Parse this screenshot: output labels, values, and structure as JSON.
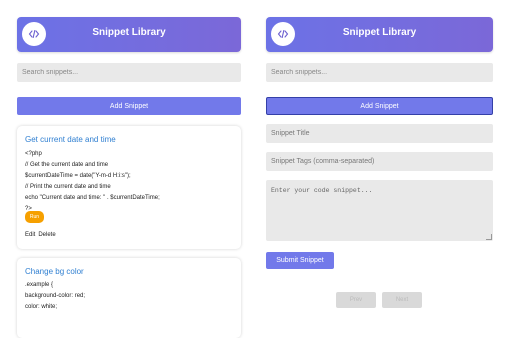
{
  "left": {
    "header_title": "Snippet Library",
    "search_placeholder": "Search snippets...",
    "add_button": "Add Snippet",
    "snippets": [
      {
        "title": "Get current date and time",
        "code": "<?php\n// Get the current date and time\n$currentDateTime = date(\"Y-m-d H:i:s\");\n// Print the current date and time\necho \"Current date and time: \" . $currentDateTime;\n?>",
        "run_label": "Run",
        "edit_label": "Edit",
        "delete_label": "Delete"
      },
      {
        "title": "Change bg color",
        "code": ".example {\nbackground-color: red;\ncolor: white;"
      }
    ]
  },
  "right": {
    "header_title": "Snippet Library",
    "search_placeholder": "Search snippets...",
    "add_button": "Add Snippet",
    "form": {
      "title_placeholder": "Snippet Title",
      "tags_placeholder": "Snippet Tags (comma-separated)",
      "code_placeholder": "Enter your code snippet...",
      "submit_label": "Submit Snippet"
    },
    "pagination": {
      "prev_label": "Prev",
      "next_label": "Next"
    }
  }
}
